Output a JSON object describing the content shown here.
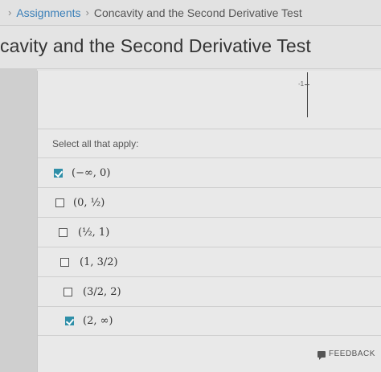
{
  "breadcrumb": {
    "items": [
      "Assignments",
      "Concavity and the Second Derivative Test"
    ]
  },
  "page": {
    "title": "cavity and the Second Derivative Test"
  },
  "graph": {
    "tick_label": "-1"
  },
  "question": {
    "prompt": "Select all that apply:",
    "options": [
      {
        "label": "(−∞, 0)",
        "checked": true
      },
      {
        "label": "(0, ½)",
        "checked": false
      },
      {
        "label": "(½, 1)",
        "checked": false
      },
      {
        "label": "(1, 3/2)",
        "checked": false
      },
      {
        "label": "(3/2, 2)",
        "checked": false
      },
      {
        "label": "(2, ∞)",
        "checked": true
      }
    ]
  },
  "footer": {
    "feedback_label": "FEEDBACK"
  },
  "colors": {
    "accent": "#2f8fa8",
    "link": "#3a7fb8"
  }
}
